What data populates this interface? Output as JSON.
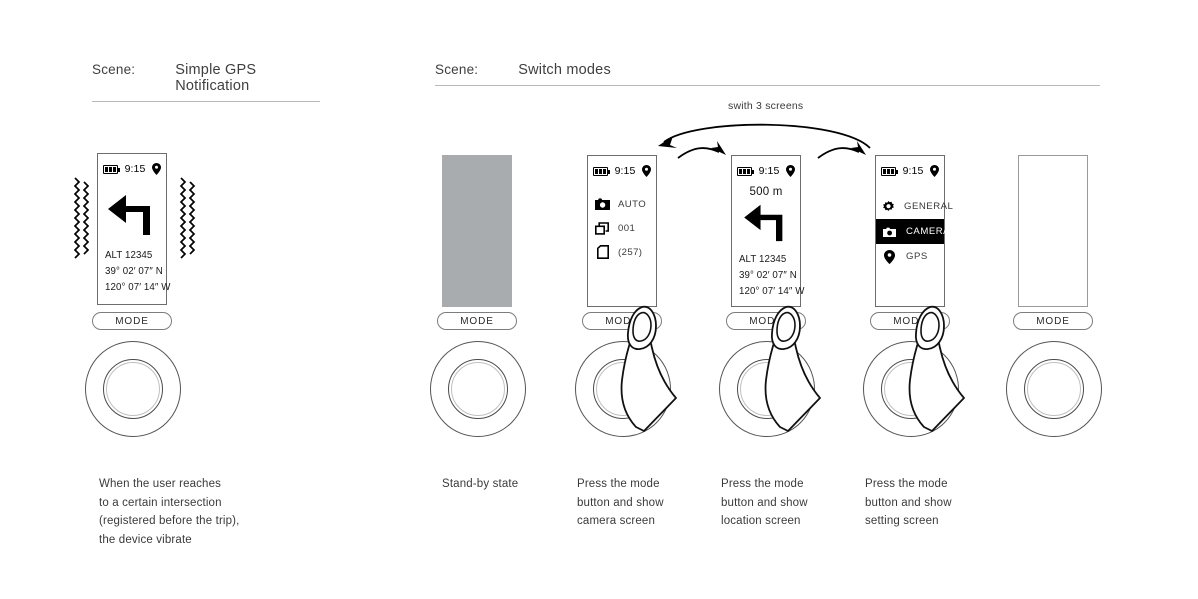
{
  "scenes": [
    {
      "label": "Scene:",
      "title": "Simple GPS Notification"
    },
    {
      "label": "Scene:",
      "title": "Switch modes"
    }
  ],
  "annotation": {
    "switch_label": "swith 3 screens"
  },
  "common": {
    "mode_button_label": "MODE",
    "status": {
      "time": "9:15",
      "battery_icon": "battery-icon",
      "location_icon": "location-pin-icon"
    }
  },
  "scene1": {
    "screen": {
      "name": "gps-notification-screen",
      "turn_icon": "turn-left-arrow-icon",
      "alt_line": "ALT  12345",
      "lat_line": "39° 02′ 07″ N",
      "lon_line": "120° 07′ 14″ W"
    },
    "vibration_icon": "vibration-waves-icon",
    "caption": [
      "When the user reaches",
      "to a certain intersection",
      "(registered before the trip),",
      "the device vibrate"
    ]
  },
  "scene2": {
    "steps": [
      {
        "name": "standby",
        "screen_type": "standby",
        "caption": [
          "Stand-by state"
        ],
        "finger": false
      },
      {
        "name": "camera",
        "screen_type": "camera",
        "rows": [
          {
            "icon": "camera-icon",
            "text": "AUTO"
          },
          {
            "icon": "copies-stack-icon",
            "text": "001"
          },
          {
            "icon": "sd-card-icon",
            "text": "(257)"
          }
        ],
        "caption": [
          "Press the mode",
          "button and show",
          "camera screen"
        ],
        "finger": true
      },
      {
        "name": "location",
        "screen_type": "location",
        "distance": "500 m",
        "turn_icon": "turn-left-arrow-icon",
        "alt_line": "ALT  12345",
        "lat_line": "39° 02′ 07″ N",
        "lon_line": "120° 07′ 14″ W",
        "caption": [
          "Press the mode",
          "button and show",
          "location screen"
        ],
        "finger": true
      },
      {
        "name": "setting",
        "screen_type": "setting",
        "menu": [
          {
            "icon": "gear-icon",
            "text": "GENERAL",
            "selected": false
          },
          {
            "icon": "camera-icon",
            "text": "CAMERA",
            "selected": true
          },
          {
            "icon": "location-pin-icon",
            "text": "GPS",
            "selected": false
          }
        ],
        "caption": [
          "Press the mode",
          "button and show",
          "setting screen"
        ],
        "finger": true
      },
      {
        "name": "blank",
        "screen_type": "blank",
        "caption": [],
        "finger": false
      }
    ]
  },
  "colors": {
    "ink": "#231f20",
    "standby_gray": "#a9acae",
    "rule": "#b9b9b9",
    "selected_bg": "#000000"
  }
}
